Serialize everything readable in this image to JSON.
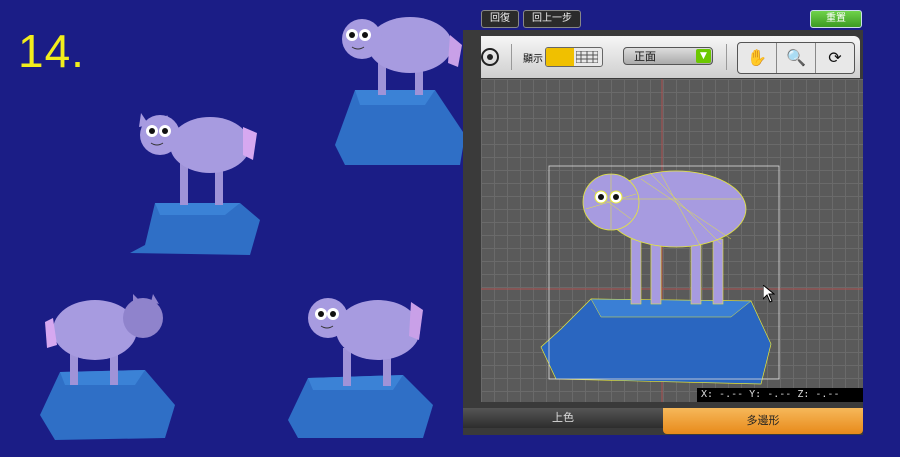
{
  "step": {
    "number": "14."
  },
  "toolbar_top": {
    "undo_label": "回復",
    "back_label": "回上一步",
    "reset_label": "重置"
  },
  "editor_toolbar": {
    "display_label": "顯示",
    "view_select_value": "正面",
    "tools": [
      "hand-tool-icon",
      "zoom-icon",
      "camera-rotate-icon"
    ]
  },
  "viewport": {
    "coords_text": "X: -.-- Y: -.-- Z: -.--"
  },
  "tabs": {
    "color_label": "上色",
    "polygon_label": "多邊形"
  },
  "colors": {
    "background": "#1b1d86",
    "sheep_body": "#a79be0",
    "rock": "#2f6fc6",
    "wire": "#e6e83a",
    "accent": "#e88a1a"
  }
}
